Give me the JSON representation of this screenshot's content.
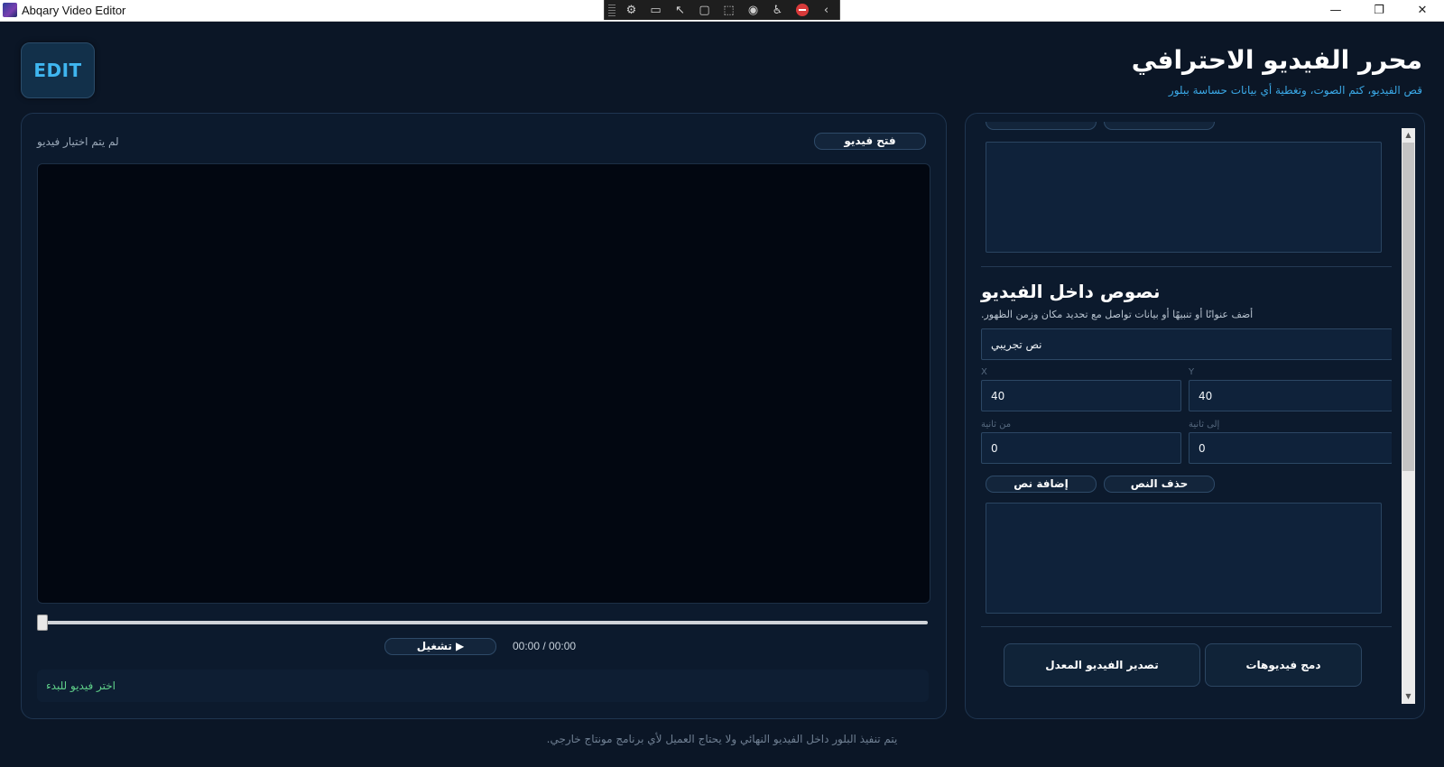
{
  "window": {
    "title": "Abqary Video Editor",
    "controls": [
      "—",
      "❐",
      "✕"
    ]
  },
  "floating_toolbar": {
    "icons": [
      "settings-icon",
      "camera-icon",
      "pointer-icon",
      "frame-icon",
      "region-icon",
      "broadcast-icon",
      "accessibility-icon",
      "stop-icon",
      "collapse-icon"
    ],
    "glyphs": [
      "⚙",
      "▭",
      "↖",
      "▢",
      "⬚",
      "◉",
      "♿",
      "",
      "‹"
    ]
  },
  "header": {
    "logo": "EDIT",
    "title": "محرر الفيديو الاحترافي",
    "subtitle": "قص الفيديو، كتم الصوت، وتغطية أي بيانات حساسة ببلور"
  },
  "player": {
    "open_button": "فتح فيديو",
    "no_video": "لم يتم اختيار فيديو",
    "play_button": "▶  تشغيل",
    "time": "00:00 / 00:00",
    "status": "اختر فيديو للبدء",
    "progress": 0
  },
  "blur_section": {
    "buttons_partial": [
      "",
      ""
    ]
  },
  "text_section": {
    "title": "نصوص داخل الفيديو",
    "description": "أضف عنوانًا أو تنبيهًا أو بيانات تواصل مع تحديد مكان وزمن الظهور.",
    "text_value": "نص تجريبي",
    "x_label": "X",
    "x_value": "40",
    "y_label": "Y",
    "y_value": "40",
    "from_label": "من ثانية",
    "from_value": "0",
    "to_label": "إلى ثانية",
    "to_value": "0",
    "add_button": "إضافة نص",
    "delete_button": "حذف النص"
  },
  "actions": {
    "export_button": "تصدير الفيديو المعدل",
    "merge_button": "دمج فيديوهات"
  },
  "footer": {
    "note": "يتم تنفيذ البلور داخل الفيديو النهائي ولا يحتاج العميل لأي برنامج مونتاج خارجي."
  }
}
